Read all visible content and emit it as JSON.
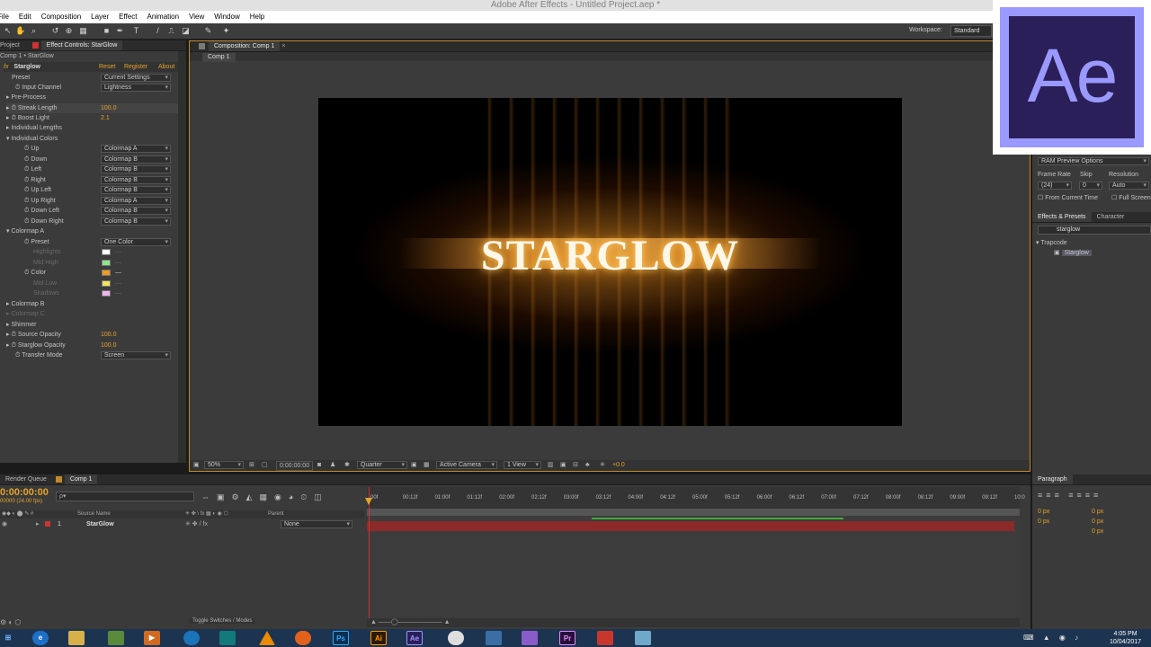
{
  "window": {
    "title": "Adobe After Effects - Untitled Project.aep *"
  },
  "menu": [
    "File",
    "Edit",
    "Composition",
    "Layer",
    "Effect",
    "Animation",
    "View",
    "Window",
    "Help"
  ],
  "workspace": {
    "label": "Workspace:",
    "value": "Standard"
  },
  "left_panel": {
    "tabs": {
      "project": "Project",
      "effect_controls": "Effect Controls: StarGlow"
    },
    "breadcrumb": "Comp 1 • StarGlow",
    "effect": {
      "name": "Starglow",
      "reset": "Reset",
      "register": "Register",
      "about": "About"
    },
    "rows": {
      "preset": {
        "label": "Preset",
        "value": "Current Settings"
      },
      "input_channel": {
        "label": "Input Channel",
        "value": "Lightness"
      },
      "pre_process": "Pre-Process",
      "streak_length": {
        "label": "Streak Length",
        "value": "100.0"
      },
      "boost_light": {
        "label": "Boost Light",
        "value": "2.1"
      },
      "individual_lengths": "Individual Lengths",
      "individual_colors": "Individual Colors",
      "up": {
        "label": "Up",
        "value": "Colormap A"
      },
      "down": {
        "label": "Down",
        "value": "Colormap B"
      },
      "left": {
        "label": "Left",
        "value": "Colormap B"
      },
      "right": {
        "label": "Right",
        "value": "Colormap B"
      },
      "up_left": {
        "label": "Up Left",
        "value": "Colormap B"
      },
      "up_right": {
        "label": "Up Right",
        "value": "Colormap A"
      },
      "down_left": {
        "label": "Down Left",
        "value": "Colormap B"
      },
      "down_right": {
        "label": "Down Right",
        "value": "Colormap B"
      },
      "colormap_a": "Colormap A",
      "cm_preset": {
        "label": "Preset",
        "value": "One Color"
      },
      "highlights": "Highlights",
      "mid_high": "Mid High",
      "color": "Color",
      "mid_low": "Mid Low",
      "shadows": "Shadows",
      "colormap_b": "Colormap B",
      "colormap_c": "Colormap C",
      "shimmer": "Shimmer",
      "source_opacity": {
        "label": "Source Opacity",
        "value": "100.0"
      },
      "starglow_opacity": {
        "label": "Starglow Opacity",
        "value": "100.0"
      },
      "transfer_mode": {
        "label": "Transfer Mode",
        "value": "Screen"
      }
    },
    "swatches": {
      "highlights": "#ffffff",
      "mid_high": "#8ee58a",
      "color": "#f29a1e",
      "mid_low": "#f2e456",
      "shadows": "#f0b6ee"
    }
  },
  "composition": {
    "tab": "Composition: Comp 1",
    "subtab": "Comp 1",
    "render_text": "STARGLOW",
    "footer": {
      "zoom": "50%",
      "timecode": "0:00:00:00",
      "resolution": "Quarter",
      "camera": "Active Camera",
      "views": "1 View",
      "exposure": "+0.0"
    }
  },
  "right_panel": {
    "preview": {
      "ram_options": "RAM Preview Options",
      "frame_rate_label": "Frame Rate",
      "skip_label": "Skip",
      "resolution_label": "Resolution",
      "frame_rate_value": "(24)",
      "skip_value": "0",
      "resolution_value": "Auto",
      "from_current_time": "From Current Time",
      "full_screen": "Full Screen"
    },
    "effects": {
      "tab": "Effects & Presets",
      "char_tab": "Character",
      "search": "starglow",
      "folder": "Trapcode",
      "item": "Starglow"
    },
    "paragraph": {
      "tab": "Paragraph",
      "px1": "0 px",
      "px2": "0 px",
      "px3": "0 px",
      "px4": "0 px",
      "px5": "0 px"
    }
  },
  "ae_logo": {
    "text": "Ae"
  },
  "timeline": {
    "tabs": {
      "render_queue": "Render Queue",
      "comp": "Comp 1"
    },
    "timecode": "0:00:00:00",
    "fps": "00000 (24.00 fps)",
    "search_placeholder": "ρ▾",
    "columns": {
      "source_name": "Source Name",
      "parent": "Parent"
    },
    "layer": {
      "index": "1",
      "name": "StarGlow",
      "parent": "None"
    },
    "ruler": [
      "00f",
      "00:12f",
      "01:00f",
      "01:12f",
      "02:00f",
      "02:12f",
      "03:00f",
      "03:12f",
      "04:00f",
      "04:12f",
      "05:00f",
      "05:12f",
      "06:00f",
      "06:12f",
      "07:00f",
      "07:12f",
      "08:00f",
      "08:12f",
      "09:00f",
      "09:12f",
      "10:0"
    ],
    "toggle": "Toggle Switches / Modes"
  },
  "taskbar": {
    "apps": [
      "e",
      "📁",
      "Ps",
      "Ai",
      "Ae",
      "Pr"
    ],
    "clock": {
      "time": "4:05 PM",
      "date": "10/04/2017"
    }
  },
  "colors": {
    "accent_orange": "#e4a32c",
    "layer_red": "#8c2a2a",
    "ae_purple": "#9999ff",
    "ae_bg": "#2b1f59"
  }
}
